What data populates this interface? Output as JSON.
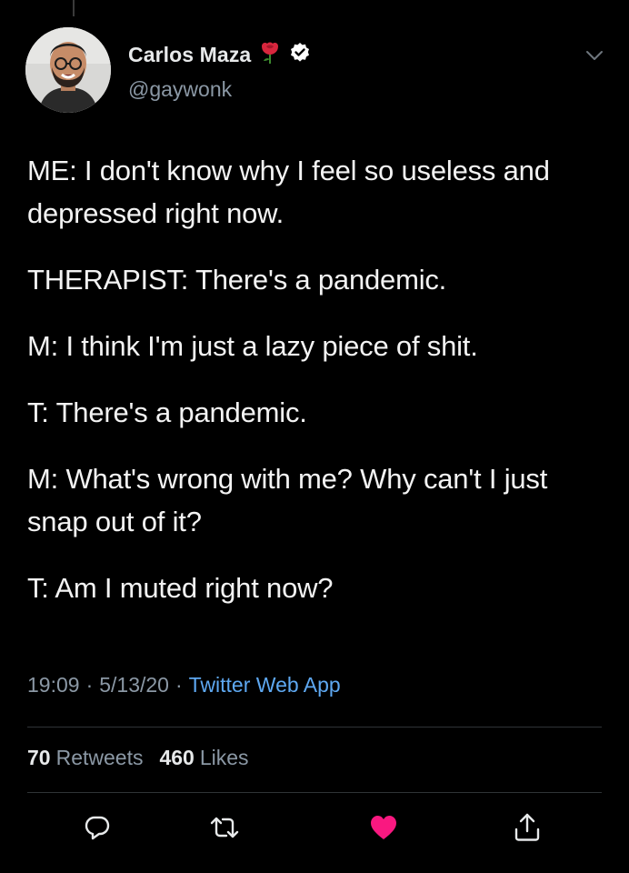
{
  "app": "Twitter",
  "author": {
    "display_name": "Carlos Maza",
    "handle": "@gaywonk",
    "name_emoji_icon": "rose-icon",
    "verified_icon": "verified-badge-icon"
  },
  "tweet": {
    "paragraphs": [
      "ME: I don't know why I feel so useless and depressed right now.",
      "THERAPIST: There's a pandemic.",
      "M: I think I'm just a lazy piece of shit.",
      "T: There's a pandemic.",
      "M: What's wrong with me? Why can't I just snap out of it?",
      "T: Am I muted right now?"
    ],
    "time": "19:09",
    "date": "5/13/20",
    "separator": "·",
    "source": "Twitter Web App"
  },
  "stats": {
    "retweets_count": "70",
    "retweets_label": "Retweets",
    "likes_count": "460",
    "likes_label": "Likes"
  },
  "actions": [
    {
      "name": "reply",
      "icon": "reply-icon"
    },
    {
      "name": "retweet",
      "icon": "retweet-icon"
    },
    {
      "name": "like",
      "icon": "heart-icon",
      "state": "liked"
    },
    {
      "name": "share",
      "icon": "share-icon"
    }
  ],
  "colors": {
    "background": "#000000",
    "text": "#e7e9ea",
    "secondary_text": "#8b98a5",
    "link": "#5ea8f1",
    "liked_heart": "#f91880",
    "verified": "#1d9bf0"
  }
}
